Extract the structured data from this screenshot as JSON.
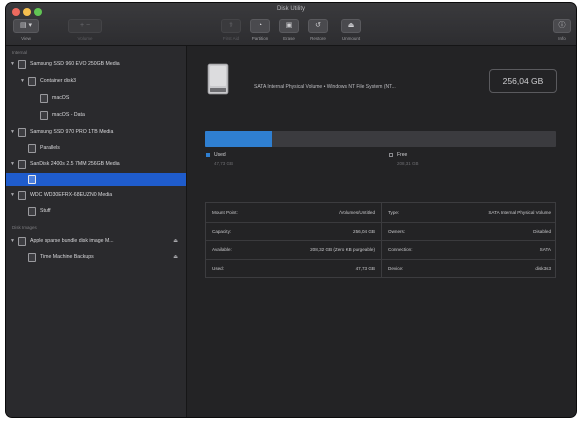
{
  "window": {
    "title": "Disk Utility",
    "traffic_colors": [
      "#ed6a5e",
      "#f5bf4f",
      "#61c554"
    ]
  },
  "toolbar": {
    "view_label": "View",
    "volume_label": "Volume",
    "first_aid_label": "First Aid",
    "partition_label": "Partition",
    "erase_label": "Erase",
    "restore_label": "Restore",
    "unmount_label": "Unmount",
    "info_label": "Info"
  },
  "sidebar": {
    "internal_header": "Internal",
    "disk_images_header": "Disk Images",
    "items": [
      {
        "label": "Samsung SSD 960 EVO 250GB Media",
        "level": 0,
        "disclosure": "▼"
      },
      {
        "label": "Container disk3",
        "level": 1,
        "disclosure": "▼"
      },
      {
        "label": "macOS",
        "level": 2,
        "disclosure": ""
      },
      {
        "label": "macOS - Data",
        "level": 2,
        "disclosure": ""
      },
      {
        "label": "Samsung SSD 970 PRO 1TB Media",
        "level": 0,
        "disclosure": "▼"
      },
      {
        "label": "Parallels",
        "level": 1,
        "disclosure": ""
      },
      {
        "label": "SanDisk 2400s 2.5 7MM 256GB Media",
        "level": 0,
        "disclosure": "▼"
      },
      {
        "label": "",
        "level": 1,
        "disclosure": "",
        "selected": true
      },
      {
        "label": "WDC WD30EFRX-68EUZN0 Media",
        "level": 0,
        "disclosure": "▼"
      },
      {
        "label": "Stuff",
        "level": 1,
        "disclosure": ""
      },
      {
        "label": "Apple sparse bundle disk image M...",
        "level": 0,
        "disclosure": "▼",
        "eject": "⏏"
      },
      {
        "label": "Time Machine Backups",
        "level": 1,
        "disclosure": "",
        "eject": "⏏"
      }
    ]
  },
  "main": {
    "volume_info": "SATA Internal Physical Volume • Windows NT File System (NT...",
    "capacity_display": "256,04 GB",
    "usage_fraction": 0.19,
    "used_color": "#2f7fd1",
    "free_color": "#3b3b3f",
    "legend": {
      "used_label": "Used",
      "used_value": "47,73 GB",
      "free_label": "Free",
      "free_value": "208,31 GB"
    },
    "info_table": [
      {
        "left_key": "Mount Point:",
        "left_val": "/Volumes/Untitled",
        "right_key": "Type:",
        "right_val": "SATA Internal Physical Volume"
      },
      {
        "left_key": "Capacity:",
        "left_val": "256,04 GB",
        "right_key": "Owners:",
        "right_val": "Disabled"
      },
      {
        "left_key": "Available:",
        "left_val": "208,32 GB (Zero KB purgeable)",
        "right_key": "Connection:",
        "right_val": "SATA"
      },
      {
        "left_key": "Used:",
        "left_val": "47,73 GB",
        "right_key": "Device:",
        "right_val": "disk3s3"
      }
    ]
  }
}
